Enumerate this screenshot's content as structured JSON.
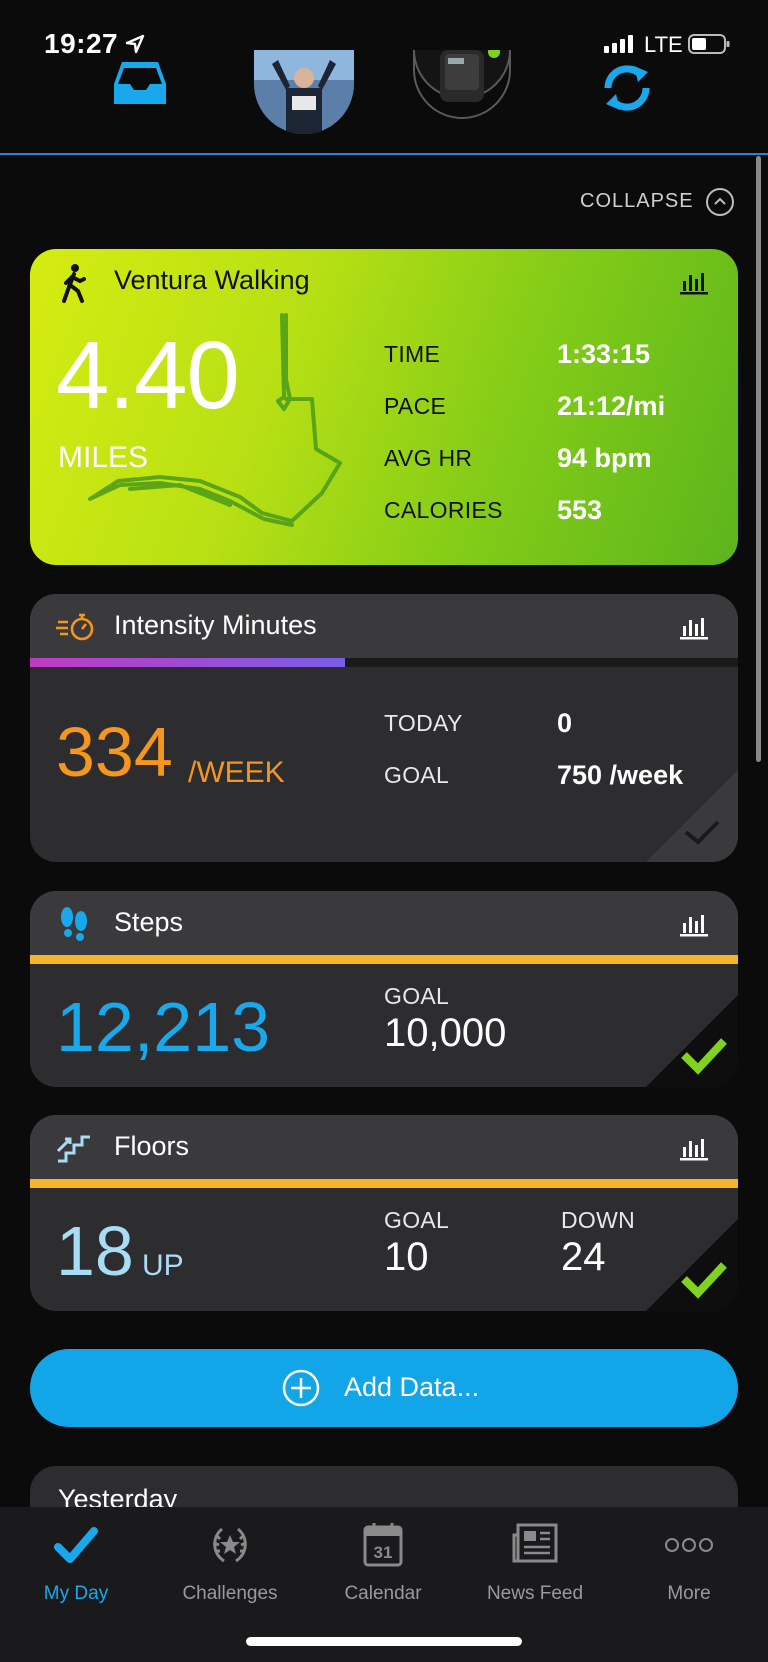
{
  "status_bar": {
    "time": "19:27",
    "network": "LTE"
  },
  "collapse": {
    "label": "COLLAPSE"
  },
  "activity": {
    "title": "Ventura Walking",
    "distance": "4.40",
    "unit": "MILES",
    "metrics": [
      {
        "label": "TIME",
        "value": "1:33:15"
      },
      {
        "label": "PACE",
        "value": "21:12/mi"
      },
      {
        "label": "AVG HR",
        "value": "94 bpm"
      },
      {
        "label": "CALORIES",
        "value": "553"
      }
    ]
  },
  "intensity": {
    "title": "Intensity Minutes",
    "value": "334",
    "unit": "/WEEK",
    "progress": 0.445,
    "today_label": "TODAY",
    "today_value": "0",
    "goal_label": "GOAL",
    "goal_value": "750 /week"
  },
  "steps": {
    "title": "Steps",
    "value": "12,213",
    "goal_label": "GOAL",
    "goal_value": "10,000",
    "progress": 1.0
  },
  "floors": {
    "title": "Floors",
    "value": "18",
    "unit": "UP",
    "goal_label": "GOAL",
    "goal_value": "10",
    "down_label": "DOWN",
    "down_value": "24",
    "progress": 1.0
  },
  "add_data": {
    "label": "Add Data..."
  },
  "yesterday": {
    "title": "Yesterday"
  },
  "tabs": [
    {
      "label": "My Day",
      "active": true
    },
    {
      "label": "Challenges",
      "active": false
    },
    {
      "label": "Calendar",
      "active": false,
      "icon_text": "31"
    },
    {
      "label": "News Feed",
      "active": false
    },
    {
      "label": "More",
      "active": false
    }
  ],
  "colors": {
    "accent_blue": "#12a6e8",
    "intensity_orange": "#f5961e",
    "steps_blue": "#1aa8ec",
    "floors_blue": "#a9dcf5",
    "goal_yellow": "#f7b52a",
    "check_green": "#7ed321"
  }
}
